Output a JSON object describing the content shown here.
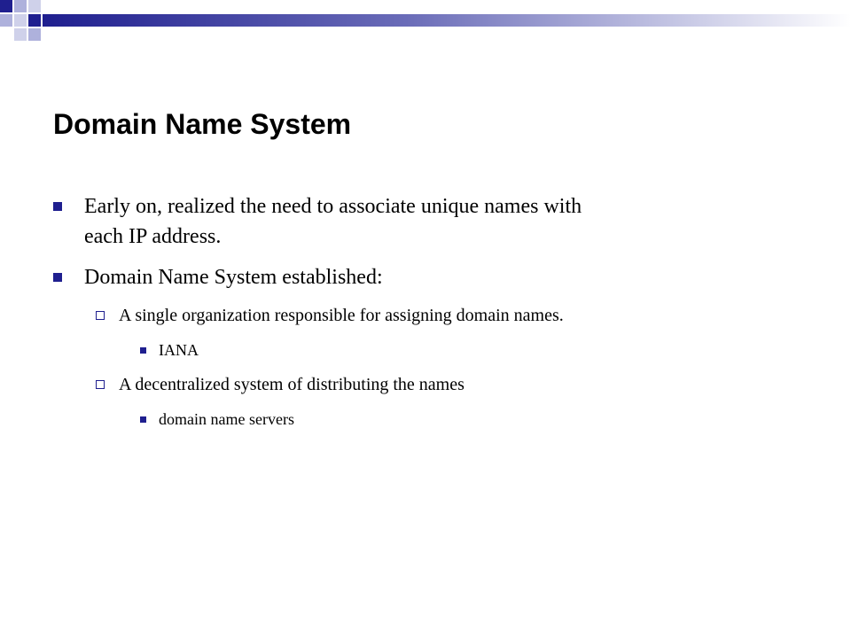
{
  "slide": {
    "title": "Domain Name System",
    "bullets": [
      {
        "level": 1,
        "lines": [
          "Early on, realized the need to associate unique names with",
          "each IP address."
        ]
      },
      {
        "level": 1,
        "lines": [
          "Domain Name System established:"
        ]
      },
      {
        "level": 2,
        "lines": [
          "A single organization responsible for assigning domain names."
        ]
      },
      {
        "level": 3,
        "lines": [
          "IANA"
        ]
      },
      {
        "level": 2,
        "lines": [
          "A decentralized system of distributing the names"
        ]
      },
      {
        "level": 3,
        "lines": [
          "domain name servers"
        ]
      }
    ]
  },
  "colors": {
    "accent": "#1f1f8f",
    "accent_light": "#aeb1dc",
    "accent_pale": "#cfd1ea",
    "background": "#ffffff",
    "text": "#000000"
  }
}
